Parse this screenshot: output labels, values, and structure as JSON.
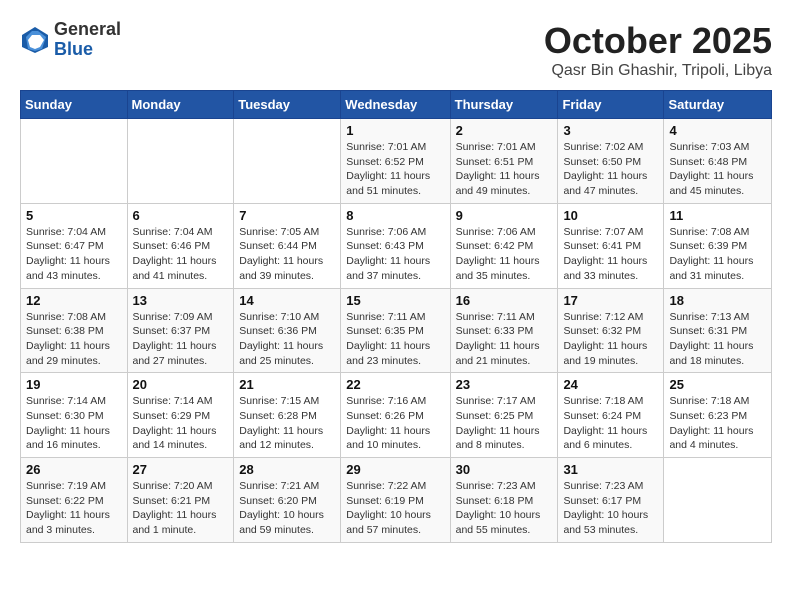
{
  "header": {
    "logo_general": "General",
    "logo_blue": "Blue",
    "title": "October 2025",
    "subtitle": "Qasr Bin Ghashir, Tripoli, Libya"
  },
  "weekdays": [
    "Sunday",
    "Monday",
    "Tuesday",
    "Wednesday",
    "Thursday",
    "Friday",
    "Saturday"
  ],
  "weeks": [
    [
      {
        "day": "",
        "info": ""
      },
      {
        "day": "",
        "info": ""
      },
      {
        "day": "",
        "info": ""
      },
      {
        "day": "1",
        "info": "Sunrise: 7:01 AM\nSunset: 6:52 PM\nDaylight: 11 hours\nand 51 minutes."
      },
      {
        "day": "2",
        "info": "Sunrise: 7:01 AM\nSunset: 6:51 PM\nDaylight: 11 hours\nand 49 minutes."
      },
      {
        "day": "3",
        "info": "Sunrise: 7:02 AM\nSunset: 6:50 PM\nDaylight: 11 hours\nand 47 minutes."
      },
      {
        "day": "4",
        "info": "Sunrise: 7:03 AM\nSunset: 6:48 PM\nDaylight: 11 hours\nand 45 minutes."
      }
    ],
    [
      {
        "day": "5",
        "info": "Sunrise: 7:04 AM\nSunset: 6:47 PM\nDaylight: 11 hours\nand 43 minutes."
      },
      {
        "day": "6",
        "info": "Sunrise: 7:04 AM\nSunset: 6:46 PM\nDaylight: 11 hours\nand 41 minutes."
      },
      {
        "day": "7",
        "info": "Sunrise: 7:05 AM\nSunset: 6:44 PM\nDaylight: 11 hours\nand 39 minutes."
      },
      {
        "day": "8",
        "info": "Sunrise: 7:06 AM\nSunset: 6:43 PM\nDaylight: 11 hours\nand 37 minutes."
      },
      {
        "day": "9",
        "info": "Sunrise: 7:06 AM\nSunset: 6:42 PM\nDaylight: 11 hours\nand 35 minutes."
      },
      {
        "day": "10",
        "info": "Sunrise: 7:07 AM\nSunset: 6:41 PM\nDaylight: 11 hours\nand 33 minutes."
      },
      {
        "day": "11",
        "info": "Sunrise: 7:08 AM\nSunset: 6:39 PM\nDaylight: 11 hours\nand 31 minutes."
      }
    ],
    [
      {
        "day": "12",
        "info": "Sunrise: 7:08 AM\nSunset: 6:38 PM\nDaylight: 11 hours\nand 29 minutes."
      },
      {
        "day": "13",
        "info": "Sunrise: 7:09 AM\nSunset: 6:37 PM\nDaylight: 11 hours\nand 27 minutes."
      },
      {
        "day": "14",
        "info": "Sunrise: 7:10 AM\nSunset: 6:36 PM\nDaylight: 11 hours\nand 25 minutes."
      },
      {
        "day": "15",
        "info": "Sunrise: 7:11 AM\nSunset: 6:35 PM\nDaylight: 11 hours\nand 23 minutes."
      },
      {
        "day": "16",
        "info": "Sunrise: 7:11 AM\nSunset: 6:33 PM\nDaylight: 11 hours\nand 21 minutes."
      },
      {
        "day": "17",
        "info": "Sunrise: 7:12 AM\nSunset: 6:32 PM\nDaylight: 11 hours\nand 19 minutes."
      },
      {
        "day": "18",
        "info": "Sunrise: 7:13 AM\nSunset: 6:31 PM\nDaylight: 11 hours\nand 18 minutes."
      }
    ],
    [
      {
        "day": "19",
        "info": "Sunrise: 7:14 AM\nSunset: 6:30 PM\nDaylight: 11 hours\nand 16 minutes."
      },
      {
        "day": "20",
        "info": "Sunrise: 7:14 AM\nSunset: 6:29 PM\nDaylight: 11 hours\nand 14 minutes."
      },
      {
        "day": "21",
        "info": "Sunrise: 7:15 AM\nSunset: 6:28 PM\nDaylight: 11 hours\nand 12 minutes."
      },
      {
        "day": "22",
        "info": "Sunrise: 7:16 AM\nSunset: 6:26 PM\nDaylight: 11 hours\nand 10 minutes."
      },
      {
        "day": "23",
        "info": "Sunrise: 7:17 AM\nSunset: 6:25 PM\nDaylight: 11 hours\nand 8 minutes."
      },
      {
        "day": "24",
        "info": "Sunrise: 7:18 AM\nSunset: 6:24 PM\nDaylight: 11 hours\nand 6 minutes."
      },
      {
        "day": "25",
        "info": "Sunrise: 7:18 AM\nSunset: 6:23 PM\nDaylight: 11 hours\nand 4 minutes."
      }
    ],
    [
      {
        "day": "26",
        "info": "Sunrise: 7:19 AM\nSunset: 6:22 PM\nDaylight: 11 hours\nand 3 minutes."
      },
      {
        "day": "27",
        "info": "Sunrise: 7:20 AM\nSunset: 6:21 PM\nDaylight: 11 hours\nand 1 minute."
      },
      {
        "day": "28",
        "info": "Sunrise: 7:21 AM\nSunset: 6:20 PM\nDaylight: 10 hours\nand 59 minutes."
      },
      {
        "day": "29",
        "info": "Sunrise: 7:22 AM\nSunset: 6:19 PM\nDaylight: 10 hours\nand 57 minutes."
      },
      {
        "day": "30",
        "info": "Sunrise: 7:23 AM\nSunset: 6:18 PM\nDaylight: 10 hours\nand 55 minutes."
      },
      {
        "day": "31",
        "info": "Sunrise: 7:23 AM\nSunset: 6:17 PM\nDaylight: 10 hours\nand 53 minutes."
      },
      {
        "day": "",
        "info": ""
      }
    ]
  ]
}
